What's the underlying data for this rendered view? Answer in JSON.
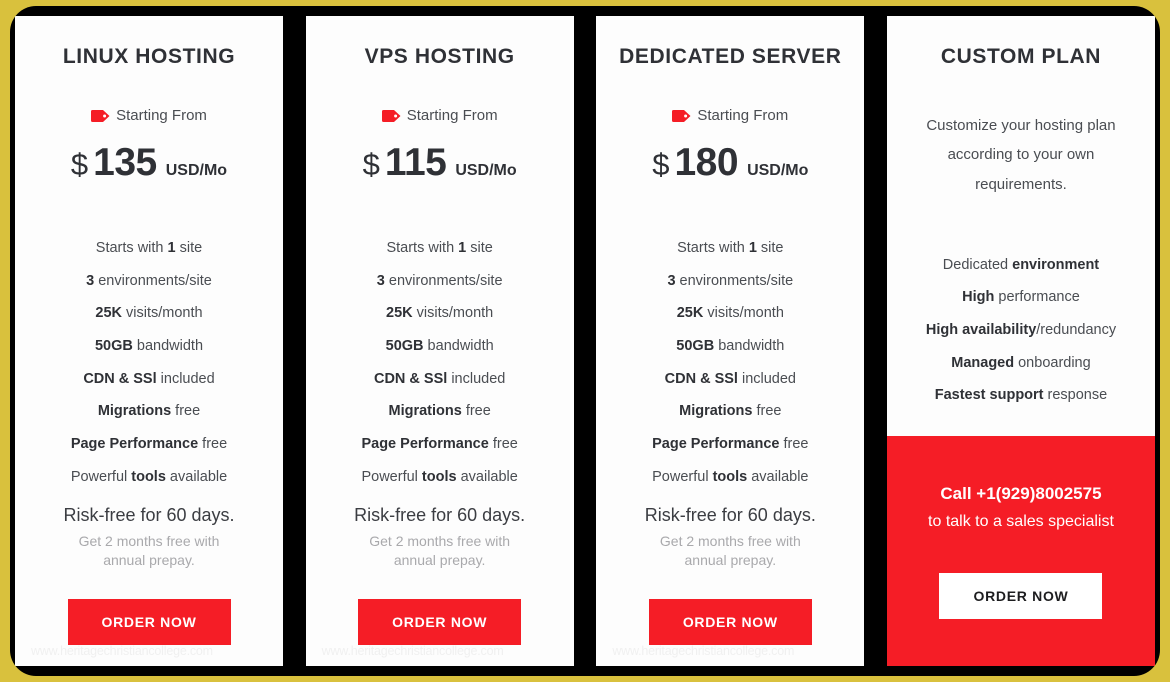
{
  "theme": {
    "accent_red": "#f51d26",
    "border_gold": "#d9c13d",
    "stage_black": "#000000",
    "card_bg": "#fdfdfd",
    "text_dark": "#2f3136",
    "text_body": "#4a4d52",
    "text_muted": "#a9a9ac"
  },
  "watermark": "www.heritagechristiancollege.com",
  "common": {
    "starting_label": "Starting From",
    "currency": "$",
    "period": "USD/Mo",
    "riskfree": "Risk-free for 60 days.",
    "prepay": "Get 2 months free with annual prepay.",
    "order_label": "ORDER NOW",
    "tag_icon": "price-tag-icon"
  },
  "plans": [
    {
      "title": "LINUX HOSTING",
      "price": "135",
      "features": [
        {
          "pre": "Starts with ",
          "bold": "1",
          "post": " site"
        },
        {
          "pre": "",
          "bold": "3",
          "post": " environments/site"
        },
        {
          "pre": "",
          "bold": "25K",
          "post": " visits/month"
        },
        {
          "pre": "",
          "bold": "50GB",
          "post": " bandwidth"
        },
        {
          "pre": "",
          "bold": "CDN & SSl",
          "post": " included"
        },
        {
          "pre": "",
          "bold": "Migrations",
          "post": " free"
        },
        {
          "pre": "",
          "bold": "Page Performance",
          "post": " free"
        },
        {
          "pre": "Powerful ",
          "bold": "tools",
          "post": " available"
        }
      ]
    },
    {
      "title": "VPS HOSTING",
      "price": "115",
      "features": [
        {
          "pre": "Starts with ",
          "bold": "1",
          "post": " site"
        },
        {
          "pre": "",
          "bold": "3",
          "post": " environments/site"
        },
        {
          "pre": "",
          "bold": "25K",
          "post": " visits/month"
        },
        {
          "pre": "",
          "bold": "50GB",
          "post": " bandwidth"
        },
        {
          "pre": "",
          "bold": "CDN & SSl",
          "post": " included"
        },
        {
          "pre": "",
          "bold": "Migrations",
          "post": " free"
        },
        {
          "pre": "",
          "bold": "Page Performance",
          "post": " free"
        },
        {
          "pre": "Powerful ",
          "bold": "tools",
          "post": " available"
        }
      ]
    },
    {
      "title": "DEDICATED SERVER",
      "price": "180",
      "features": [
        {
          "pre": "Starts with ",
          "bold": "1",
          "post": " site"
        },
        {
          "pre": "",
          "bold": "3",
          "post": " environments/site"
        },
        {
          "pre": "",
          "bold": "25K",
          "post": " visits/month"
        },
        {
          "pre": "",
          "bold": "50GB",
          "post": " bandwidth"
        },
        {
          "pre": "",
          "bold": "CDN & SSl",
          "post": " included"
        },
        {
          "pre": "",
          "bold": "Migrations",
          "post": " free"
        },
        {
          "pre": "",
          "bold": "Page Performance",
          "post": " free"
        },
        {
          "pre": "Powerful ",
          "bold": "tools",
          "post": " available"
        }
      ]
    }
  ],
  "custom": {
    "title": "CUSTOM PLAN",
    "description": "Customize your hosting plan according to your own requirements.",
    "features": [
      {
        "pre": "Dedicated ",
        "bold": "environment",
        "post": ""
      },
      {
        "pre": "",
        "bold": "High",
        "post": " performance"
      },
      {
        "pre": "",
        "bold": "High availability",
        "post": "/redundancy"
      },
      {
        "pre": "",
        "bold": "Managed",
        "post": " onboarding"
      },
      {
        "pre": "",
        "bold": "Fastest support",
        "post": " response"
      }
    ],
    "cta_phone": "Call +1(929)8002575",
    "cta_sub": "to talk to a sales specialist",
    "cta_button": "ORDER NOW"
  }
}
